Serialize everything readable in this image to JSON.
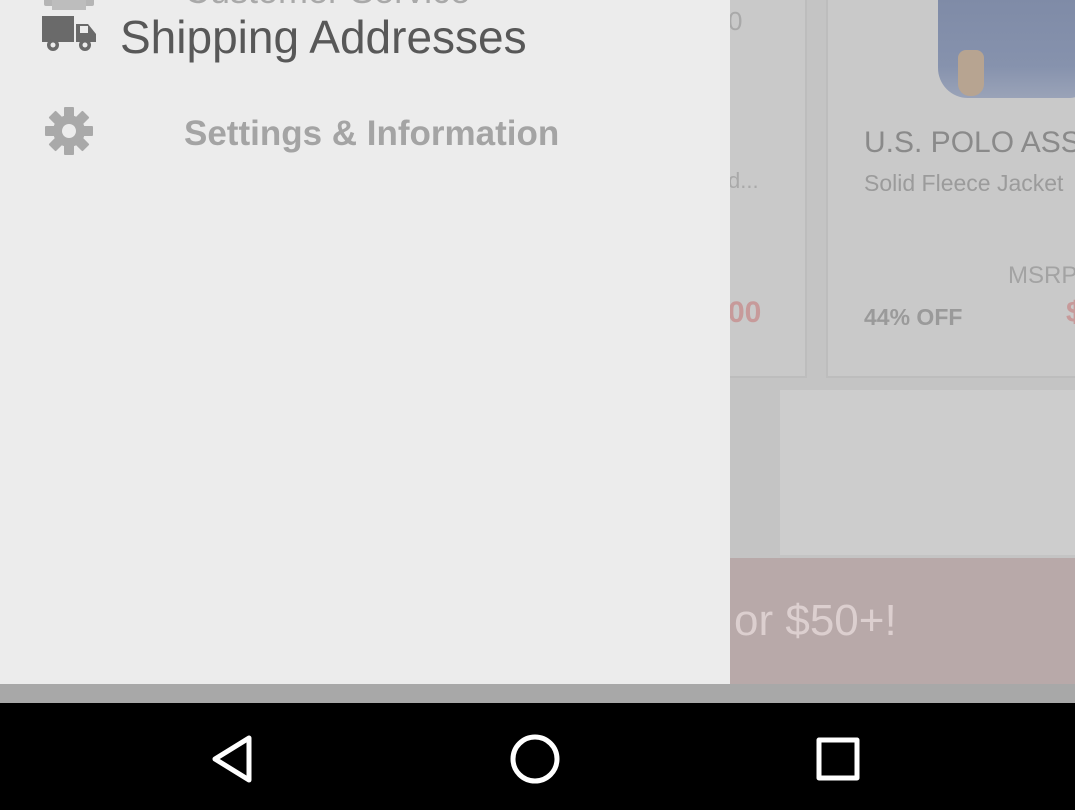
{
  "background_app": {
    "left_card": {
      "top_fragment": "0",
      "title_fragment": "d...",
      "price_fragment": "00"
    },
    "right_card": {
      "brand": "U.S. POLO ASS",
      "subtitle": "Solid Fleece Jacket",
      "msrp": "MSRP",
      "discount": "44% OFF",
      "price_fragment": "$"
    },
    "promo_banner_fragment": "or $50+!"
  },
  "drawer": {
    "items": [
      {
        "label": "Customer Service",
        "icon": "customer-service-icon"
      },
      {
        "label": "Shipping Addresses",
        "icon": "truck-icon"
      },
      {
        "label": "Settings & Information",
        "icon": "gear-icon"
      }
    ]
  },
  "nav_bar": {
    "buttons": [
      {
        "icon": "back-triangle-icon"
      },
      {
        "icon": "home-circle-icon"
      },
      {
        "icon": "recents-square-icon"
      }
    ]
  },
  "colors": {
    "drawer_bg": "#ececec",
    "scrim_bg": "#c4c4c4",
    "nav_bar": "#000000",
    "nav_icon": "#ffffff",
    "promo_banner": "#b8a9a9"
  }
}
